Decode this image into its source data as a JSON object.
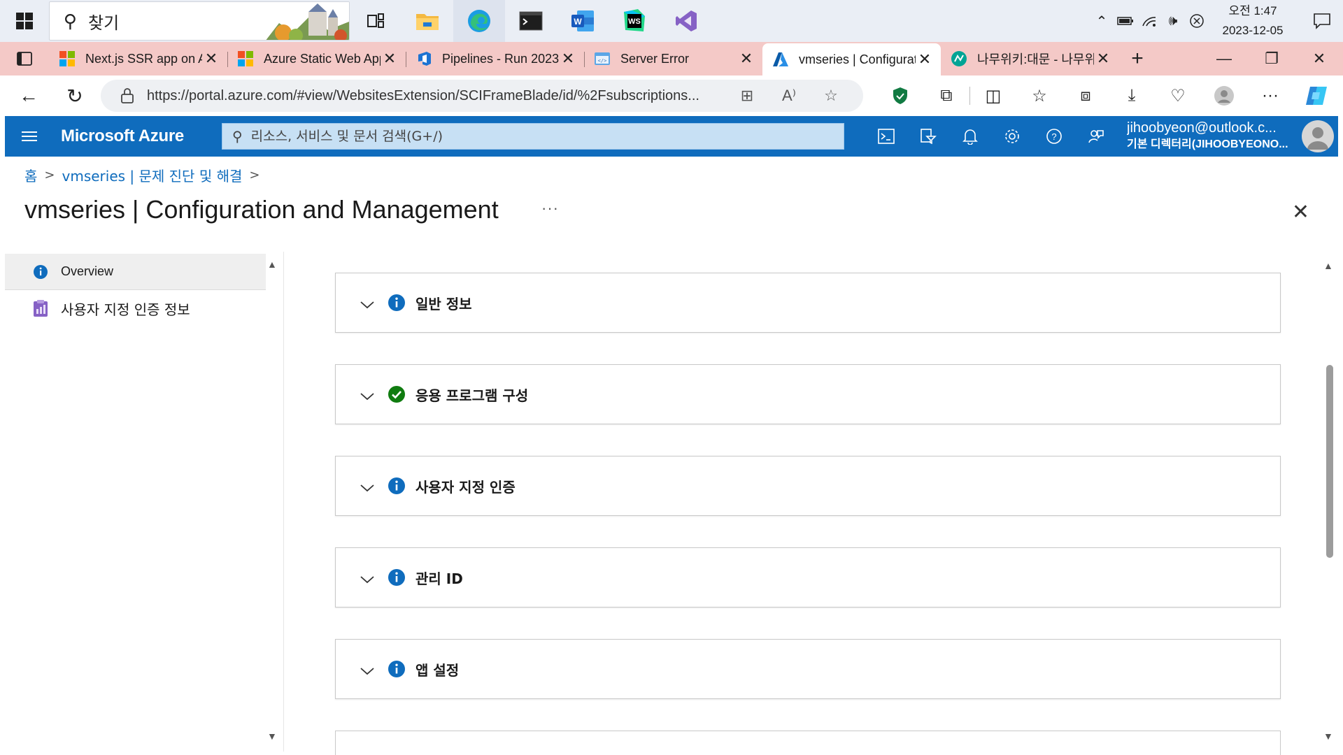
{
  "taskbar": {
    "search_label": "찾기",
    "apps": [
      "task-view",
      "file-explorer",
      "edge",
      "terminal",
      "word",
      "webstorm",
      "visual-studio"
    ],
    "clock_time": "오전 1:47",
    "clock_date": "2023-12-05"
  },
  "browser": {
    "tabs": [
      {
        "title": "Next.js SSR app on Azure",
        "icon": "microsoft-icon",
        "active": false
      },
      {
        "title": "Azure Static Web Apps",
        "icon": "microsoft-icon",
        "active": false
      },
      {
        "title": "Pipelines - Run 2023",
        "icon": "azure-devops-icon",
        "active": false
      },
      {
        "title": "Server Error",
        "icon": "webpage-icon",
        "active": false
      },
      {
        "title": "vmseries | Configuration",
        "icon": "azure-icon",
        "active": true
      },
      {
        "title": "나무위키:대문 - 나무위키",
        "icon": "namuwiki-icon",
        "active": false
      }
    ],
    "url": "https://portal.azure.com/#view/WebsitesExtension/SCIFrameBlade/id/%2Fsubscriptions..."
  },
  "azure": {
    "brand": "Microsoft Azure",
    "search_placeholder": "리소스, 서비스 및 문서 검색(G+/)",
    "account_email": "jihoobyeon@outlook.c...",
    "account_directory": "기본 디렉터리(JIHOOBYEONO...",
    "accent_color": "#0f6cbd"
  },
  "blade": {
    "breadcrumb": [
      {
        "label": "홈"
      },
      {
        "label": "vmseries | 문제 진단 및 해결"
      }
    ],
    "title": "vmseries | Configuration and Management",
    "more": "···",
    "menu": [
      {
        "label": "Overview",
        "icon": "info-icon",
        "selected": true
      },
      {
        "label": "사용자 지정 인증 정보",
        "icon": "custom-auth-icon",
        "selected": false
      }
    ],
    "sections": [
      {
        "title": "일반 정보",
        "status": "info"
      },
      {
        "title": "응용 프로그램 구성",
        "status": "success"
      },
      {
        "title": "사용자 지정 인증",
        "status": "info"
      },
      {
        "title": "관리 ID",
        "status": "info"
      },
      {
        "title": "앱 설정",
        "status": "info"
      },
      {
        "title": "",
        "status": "info"
      }
    ],
    "status_colors": {
      "info": "#0f6cbd",
      "success": "#107c10"
    }
  }
}
